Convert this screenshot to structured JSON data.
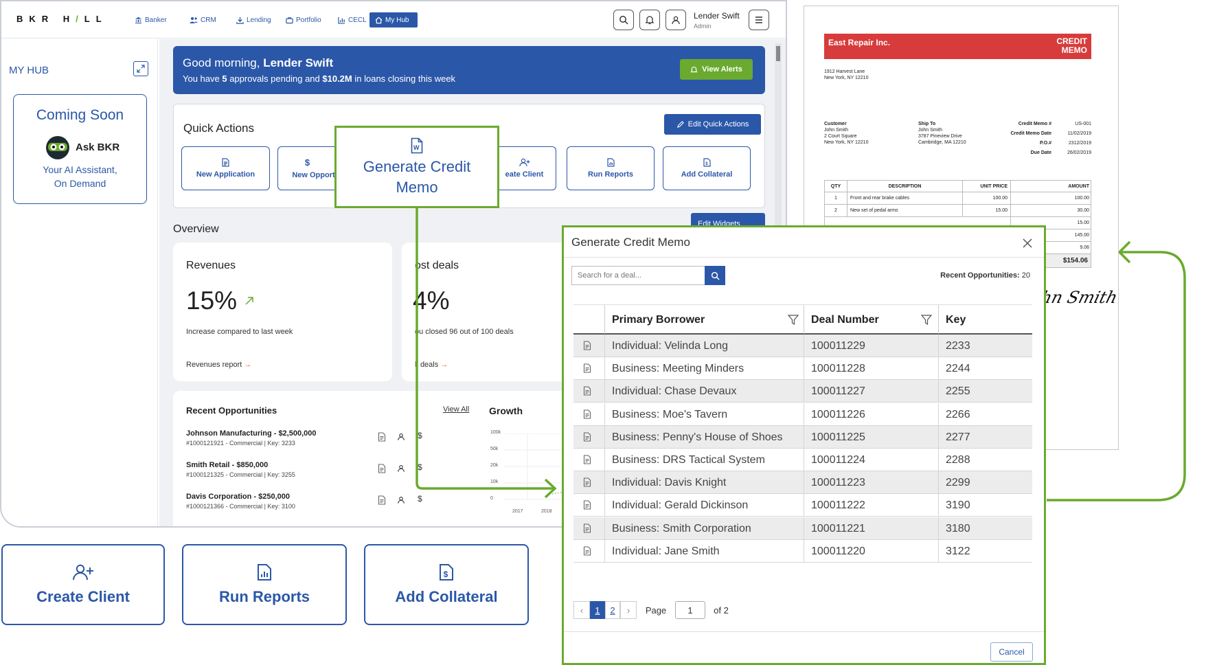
{
  "app": {
    "logo_a": "BKR H",
    "logo_slash": "/",
    "logo_b": "LL",
    "nav": [
      {
        "label": "Banker",
        "icon": "bank-icon"
      },
      {
        "label": "CRM",
        "icon": "users-icon"
      },
      {
        "label": "Lending",
        "icon": "download-icon"
      },
      {
        "label": "Portfolio",
        "icon": "briefcase-icon"
      },
      {
        "label": "CECL",
        "icon": "chart-icon"
      },
      {
        "label": "My Hub",
        "icon": "home-icon",
        "active": true
      }
    ],
    "user": {
      "name": "Lender Swift",
      "role": "Admin"
    },
    "colors": {
      "brand": "#2b57a8",
      "accent_green": "#6aaa2e",
      "memo_red": "#d73b3b"
    }
  },
  "sidebar": {
    "title": "MY HUB",
    "coming_soon": "Coming Soon",
    "ask": "Ask BKR",
    "tagline_1": "Your AI Assistant,",
    "tagline_2": "On Demand"
  },
  "banner": {
    "greeting": "Good morning, ",
    "name": "Lender Swift",
    "line_pre": "You have ",
    "approvals": "5",
    "line_mid": " approvals pending and ",
    "amount": "$10.2M",
    "line_post": " in loans closing this week",
    "button": "View Alerts"
  },
  "quick_actions": {
    "title": "Quick Actions",
    "edit": "Edit Quick Actions",
    "items": [
      "New Application",
      "New Opport",
      "Generate Credit Memo",
      "eate Client",
      "Run Reports",
      "Add Collateral"
    ],
    "highlight_line1": "Generate Credit",
    "highlight_line2": "Memo"
  },
  "overview": {
    "title": "Overview",
    "edit_widgets": "Edit Widgets",
    "revenues": {
      "title": "Revenues",
      "value": "15%",
      "desc": "Increase compared to last week",
      "link": "Revenues report"
    },
    "lost": {
      "title": "ost deals",
      "value": "4%",
      "desc": "ou closed 96 out of 100 deals",
      "link": "ll deals"
    }
  },
  "recent_opps": {
    "title": "Recent Opportunities",
    "view_all": "View All",
    "items": [
      {
        "name": "Johnson Manufacturing - $2,500,000",
        "meta": "#1000121921 - Commercial | Key: 3233"
      },
      {
        "name": "Smith Retail - $850,000",
        "meta": "#1000121325 - Commercial | Key: 3255"
      },
      {
        "name": "Davis Corporation - $250,000",
        "meta": "#1000121366 - Commercial | Key: 3100"
      }
    ]
  },
  "growth": {
    "title": "Growth",
    "y_ticks": [
      "100k",
      "50k",
      "20k",
      "10k",
      "0"
    ],
    "x_ticks": [
      "2017",
      "2018"
    ]
  },
  "big_buttons": [
    "Create Client",
    "Run Reports",
    "Add Collateral"
  ],
  "memo": {
    "company": "East Repair Inc.",
    "doc_title_1": "CREDIT",
    "doc_title_2": "MEMO",
    "addr_1": "1912 Harvest Lane",
    "addr_2": "New York, NY 12210",
    "customer_label": "Customer",
    "customer": [
      "John Smith",
      "2 Court Square",
      "New York, NY 12210"
    ],
    "shipto_label": "Ship To",
    "shipto": [
      "John Smith",
      "3787 Pineview Drive",
      "Cambridge, MA 12210"
    ],
    "meta": [
      {
        "label": "Credit Memo #",
        "value": "US-001"
      },
      {
        "label": "Credit Memo Date",
        "value": "11/02/2019"
      },
      {
        "label": "P.O.#",
        "value": "2312/2019"
      },
      {
        "label": "Due Date",
        "value": "26/02/2019"
      }
    ],
    "headers": [
      "QTY",
      "DESCRIPTION",
      "UNIT PRICE",
      "AMOUNT"
    ],
    "lines": [
      {
        "qty": "1",
        "desc": "Front and rear brake cables",
        "price": "100.00",
        "amount": "100.00"
      },
      {
        "qty": "2",
        "desc": "New set of pedal arms",
        "price": "15.00",
        "amount": "30.00"
      }
    ],
    "totals": [
      "15.00",
      "145.00",
      "9.06"
    ],
    "grand_total": "$154.06",
    "signature": "hn Smith"
  },
  "modal": {
    "title": "Generate Credit Memo",
    "search_placeholder": "Search for a deal...",
    "recent_label": "Recent Opportunities:",
    "recent_count": "20",
    "columns": [
      "Primary Borrower",
      "Deal Number",
      "Key"
    ],
    "rows": [
      {
        "borrower": "Individual: Velinda Long",
        "deal": "100011229",
        "key": "2233"
      },
      {
        "borrower": "Business: Meeting Minders",
        "deal": "100011228",
        "key": "2244"
      },
      {
        "borrower": "Individual: Chase Devaux",
        "deal": "100011227",
        "key": "2255"
      },
      {
        "borrower": "Business: Moe's Tavern",
        "deal": "100011226",
        "key": "2266"
      },
      {
        "borrower": "Business: Penny's House of Shoes",
        "deal": "100011225",
        "key": "2277"
      },
      {
        "borrower": "Business: DRS Tactical System",
        "deal": "100011224",
        "key": "2288"
      },
      {
        "borrower": "Individual: Davis Knight",
        "deal": "100011223",
        "key": "2299"
      },
      {
        "borrower": "Individual: Gerald Dickinson",
        "deal": "100011222",
        "key": "3190"
      },
      {
        "borrower": "Business: Smith Corporation",
        "deal": "100011221",
        "key": "3180"
      },
      {
        "borrower": "Individual: Jane Smith",
        "deal": "100011220",
        "key": "3122"
      }
    ],
    "pagination": {
      "prev": "‹",
      "page1": "1",
      "page2": "2",
      "next": "›",
      "page_label": "Page",
      "page_value": "1",
      "of": "of 2"
    },
    "cancel": "Cancel"
  }
}
